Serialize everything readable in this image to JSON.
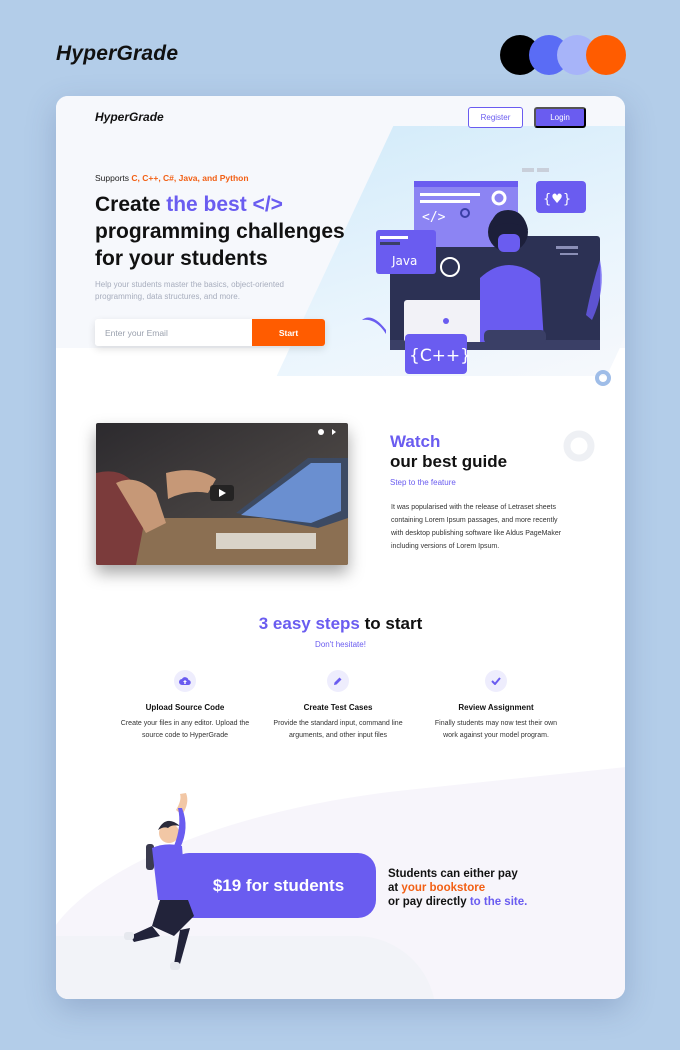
{
  "brand": "HyperGrade",
  "palette": [
    "#000000",
    "#5a6cf5",
    "#a7b4f9",
    "#ff5c00"
  ],
  "nav": {
    "logo": "HyperGrade",
    "register_label": "Register",
    "login_label": "Login"
  },
  "hero": {
    "supports_prefix": "Supports ",
    "supports_langs": "C, C++, C#, Java, and Python",
    "title_part1": "Create ",
    "title_accent": "the best </>",
    "title_part2": " programming challenges for your students",
    "subtitle": "Help your students master the basics, object-oriented programming, data structures, and more.",
    "email_placeholder": "Enter your Email",
    "start_label": "Start",
    "illustration": {
      "java_label": "Java",
      "cpp_label": "{C++}",
      "heart_label": "{♥}",
      "code_label": "</>"
    }
  },
  "guide": {
    "title_accent": "Watch",
    "title_rest": "our best guide",
    "subtitle": "Step to the feature",
    "body": "It was popularised with the release of Letraset sheets containing Lorem Ipsum passages, and more recently with desktop publishing software like Aldus PageMaker including versions of Lorem Ipsum."
  },
  "steps": {
    "title_accent": "3 easy steps",
    "title_rest": " to start",
    "subtitle": "Don't hesitate!",
    "items": [
      {
        "icon": "cloud-upload-icon",
        "title": "Upload Source Code",
        "desc": "Create your files in any editor. Upload the source code to HyperGrade"
      },
      {
        "icon": "pencil-icon",
        "title": "Create Test Cases",
        "desc": "Provide the standard input, command line arguments, and other input files"
      },
      {
        "icon": "check-icon",
        "title": "Review Assignment",
        "desc": "Finally students may now test their own work against your model program."
      }
    ]
  },
  "pricing": {
    "price_label": "$19 for students",
    "line1": "Students can either pay",
    "line2_prefix": "at ",
    "line2_accent": "your bookstore",
    "line3_prefix": "or pay directly ",
    "line3_accent": "to the site."
  },
  "colors": {
    "accent": "#6a5cf0",
    "orange": "#ff5c00",
    "background": "#b3cde9"
  }
}
